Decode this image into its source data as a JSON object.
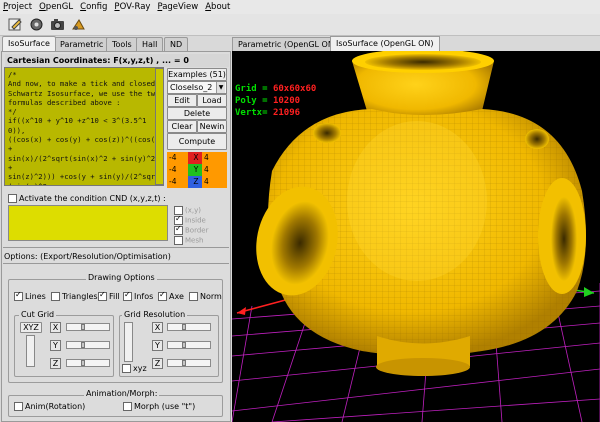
{
  "menu": [
    "Project",
    "OpenGL",
    "Config",
    "POV-Ray",
    "PageView",
    "About"
  ],
  "toolbar": {
    "icons": [
      "edit-icon",
      "gear-icon",
      "camera-icon",
      "animate-icon"
    ]
  },
  "left_tabs": [
    "IsoSurface",
    "Parametric",
    "Tools",
    "Hall",
    "ND"
  ],
  "right_tabs": [
    "Parametric (OpenGL ON)",
    "IsoSurface (OpenGL ON)"
  ],
  "coord_title": "Cartesian Coordinates: F(x,y,z,t) , ... = 0",
  "formula": "/*\nAnd now, to make a tick and closed Schwartz Isosurface, we use the two formulas described above :\n*/\nif((x^10 + y^10 +z^10 < 3^(3.5^10)),\n((cos(x) + cos(y) + cos(z))^((cos(x +\nsin(x)/(2^sqrt(sin(x)^2 + sin(y)^2 +\nsin(z)^2))) +cos(y + sin(y)/(2^sqrt(sin(x)^2\n+ sin(y)^2 + sin(z)^2))) +cos(z +\nsin(z)/(2^sqrt(sin(x)^2 + sin(y)^2 +",
  "examples_label": "Examples (51)",
  "example_selected": "CloseIso_2",
  "buttons": {
    "edit": "Edit",
    "load": "Load",
    "delete": "Delete",
    "clear": "Clear",
    "newin": "Newin",
    "compute": "Compute"
  },
  "limits": [
    {
      "min": "-4",
      "axis": "X",
      "max": "4",
      "color": "#e02020"
    },
    {
      "min": "-4",
      "axis": "Y",
      "max": "4",
      "color": "#20c020"
    },
    {
      "min": "-4",
      "axis": "Z",
      "max": "4",
      "color": "#3060e0"
    }
  ],
  "limit_bg": "#ff9900",
  "cnd": {
    "label": "Activate the condition CND (x,y,z,t) :",
    "options": [
      {
        "label": "(x,y)",
        "checked": false
      },
      {
        "label": "Inside",
        "checked": true
      },
      {
        "label": "Border",
        "checked": true
      },
      {
        "label": "Mesh",
        "checked": false
      }
    ]
  },
  "options_label": "Options: (Export/Resolution/Optimisation)",
  "drawing": {
    "title": "Drawing Options",
    "items": [
      {
        "label": "Lines",
        "checked": true
      },
      {
        "label": "Triangles",
        "checked": false
      },
      {
        "label": "Fill",
        "checked": true
      },
      {
        "label": "Infos",
        "checked": true
      },
      {
        "label": "Axe",
        "checked": true
      },
      {
        "label": "Norm",
        "checked": false
      }
    ]
  },
  "cut_grid": {
    "title": "Cut Grid",
    "xyz": "XYZ",
    "axes": [
      "X",
      "Y",
      "Z"
    ]
  },
  "grid_res": {
    "title": "Grid Resolution",
    "axes": [
      "X",
      "Y",
      "Z"
    ],
    "xyz_label": "xyz"
  },
  "animation": {
    "title": "Animation/Morph:",
    "anim_label": "Anim(Rotation)",
    "morph_label": "Morph (use \"t\")"
  },
  "stats": {
    "grid_label": "Grid = ",
    "grid": "60x60x60",
    "poly_label": "Poly = ",
    "poly": "10200",
    "vertx_label": "Vertx= ",
    "vertx": "21096"
  },
  "colors": {
    "surface": "#f2c200",
    "surface_dark": "#b88a00",
    "grid": "#c030c0",
    "formula_bg": "#b8b800",
    "cnd_bg": "#dddd00"
  }
}
